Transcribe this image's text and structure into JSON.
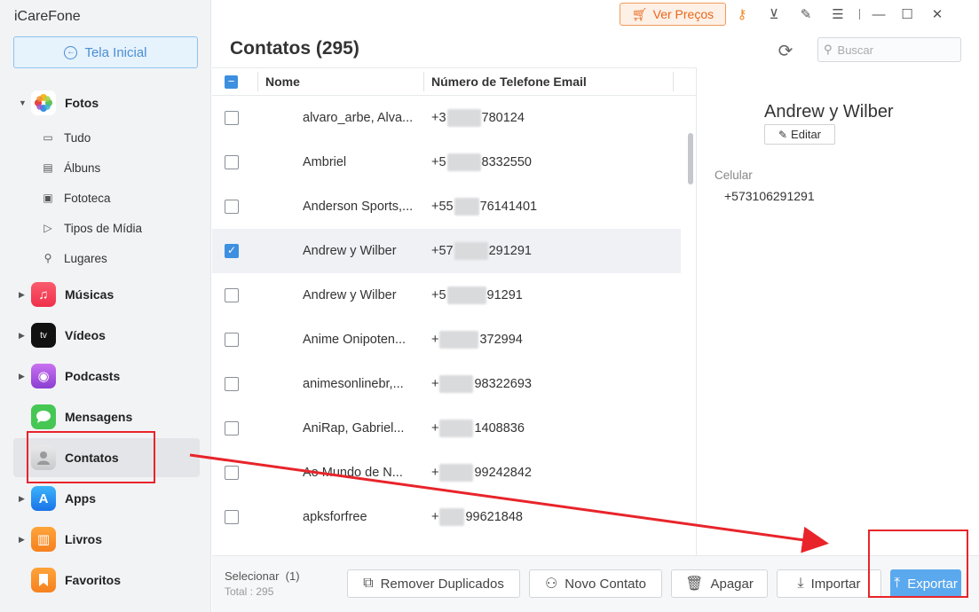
{
  "app": {
    "title": "iCareFone"
  },
  "sidebar": {
    "home_label": "Tela Inicial",
    "photos": {
      "label": "Fotos",
      "children": [
        "Tudo",
        "Álbuns",
        "Fototeca",
        "Tipos de Mídia",
        "Lugares"
      ]
    },
    "items": [
      {
        "label": "Músicas"
      },
      {
        "label": "Vídeos"
      },
      {
        "label": "Podcasts"
      },
      {
        "label": "Mensagens"
      },
      {
        "label": "Contatos"
      },
      {
        "label": "Apps"
      },
      {
        "label": "Livros"
      },
      {
        "label": "Favoritos"
      }
    ],
    "active_item": "Contatos"
  },
  "topbar": {
    "price_label": "Ver Preços"
  },
  "main": {
    "title": "Contatos (295)",
    "search_placeholder": "Buscar",
    "columns": {
      "name": "Nome",
      "phone_email": "Número de Telefone Email"
    },
    "rows": [
      {
        "name": "alvaro_arbe, Alva...",
        "phone_prefix": "+3",
        "phone_suffix": "780124",
        "checked": false
      },
      {
        "name": "Ambriel",
        "phone_prefix": "+5",
        "phone_suffix": "8332550",
        "checked": false
      },
      {
        "name": "Anderson Sports,...",
        "phone_prefix": "+55",
        "phone_suffix": "76141401",
        "checked": false
      },
      {
        "name": "Andrew y Wilber",
        "phone_prefix": "+57",
        "phone_suffix": "291291",
        "checked": true
      },
      {
        "name": "Andrew y Wilber",
        "phone_prefix": "+5",
        "phone_suffix": "91291",
        "checked": false
      },
      {
        "name": "Anime Onipoten...",
        "phone_prefix": "+",
        "phone_suffix": "372994",
        "checked": false
      },
      {
        "name": "animesonlinebr,...",
        "phone_prefix": "+",
        "phone_suffix": "98322693",
        "checked": false
      },
      {
        "name": "AniRap, Gabriel...",
        "phone_prefix": "+",
        "phone_suffix": "1408836",
        "checked": false
      },
      {
        "name": "Ao Mundo de N...",
        "phone_prefix": "+",
        "phone_suffix": "99242842",
        "checked": false
      },
      {
        "name": "apksforfree",
        "phone_prefix": "+",
        "phone_suffix": "99621848",
        "checked": false
      }
    ]
  },
  "detail": {
    "name": "Andrew y Wilber",
    "edit_label": "Editar",
    "field_label": "Celular",
    "field_value": "+573106291291"
  },
  "footer": {
    "select_label": "Selecionar",
    "select_count": "(1)",
    "total_label": "Total : 295",
    "buttons": {
      "remove_duplicates": "Remover Duplicados",
      "new_contact": "Novo Contato",
      "delete": "Apagar",
      "import": "Importar",
      "export": "Exportar"
    }
  },
  "colors": {
    "accent": "#3d8fe0",
    "price_accent": "#e8671b",
    "annotation": "#e8242a"
  }
}
